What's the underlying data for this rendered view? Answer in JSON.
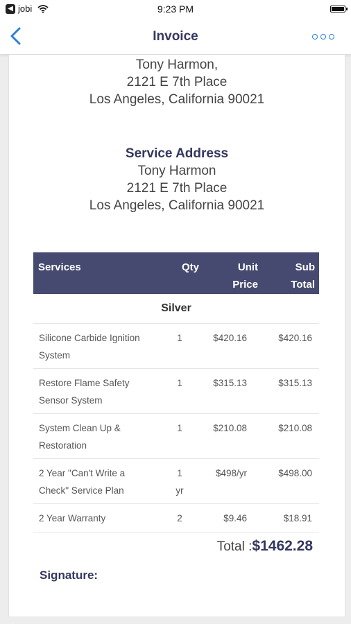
{
  "status_bar": {
    "app_back_label": "jobi",
    "time": "9:23 PM"
  },
  "nav": {
    "title": "Invoice",
    "back_icon": "chevron-left-icon",
    "more_icon": "more-dots-icon",
    "accent_color": "#2e7fd6"
  },
  "billing_address": {
    "name": "Tony Harmon,",
    "street": "2121 E 7th Place",
    "city": "Los Angeles, California 90021"
  },
  "service_address": {
    "title": "Service Address",
    "name": "Tony Harmon",
    "street": "2121 E 7th Place",
    "city": "Los Angeles, California 90021"
  },
  "table": {
    "header_color": "#464a70",
    "columns": {
      "services": "Services",
      "qty": "Qty",
      "unit_price_line1": "Unit",
      "unit_price_line2": "Price",
      "sub_total_line1": "Sub",
      "sub_total_line2": "Total"
    },
    "group": "Silver",
    "rows": [
      {
        "name_line1": "Silicone Carbide Ignition",
        "name_line2": "System",
        "qty_line1": "1",
        "qty_line2": "",
        "unit": "$420.16",
        "sub": "$420.16"
      },
      {
        "name_line1": "Restore Flame Safety",
        "name_line2": "Sensor System",
        "qty_line1": "1",
        "qty_line2": "",
        "unit": "$315.13",
        "sub": "$315.13"
      },
      {
        "name_line1": "System Clean Up &",
        "name_line2": "Restoration",
        "qty_line1": "1",
        "qty_line2": "",
        "unit": "$210.08",
        "sub": "$210.08"
      },
      {
        "name_line1": "2 Year \"Can't Write a",
        "name_line2": "Check\" Service Plan",
        "qty_line1": "1",
        "qty_line2": "yr",
        "unit": "$498/yr",
        "sub": "$498.00"
      },
      {
        "name_line1": "2 Year Warranty",
        "name_line2": "",
        "qty_line1": "2",
        "qty_line2": "",
        "unit": "$9.46",
        "sub": "$18.91"
      }
    ]
  },
  "total": {
    "label": "Total :",
    "value": "$1462.28"
  },
  "signature_label": "Signature:"
}
